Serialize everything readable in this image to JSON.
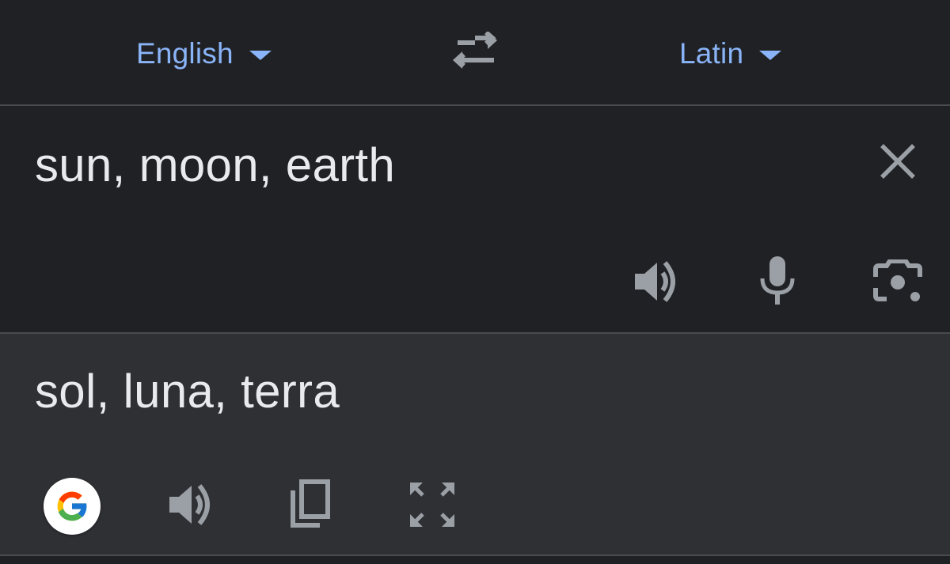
{
  "language_bar": {
    "source_language": "English",
    "target_language": "Latin"
  },
  "source": {
    "text": "sun, moon, earth"
  },
  "result": {
    "text": "sol, luna, terra"
  },
  "icons": {
    "swap": "swap-arrows-icon",
    "clear": "close-icon",
    "source_speaker": "speaker-icon",
    "mic": "microphone-icon",
    "camera": "camera-lens-icon",
    "google": "google-logo-icon",
    "result_speaker": "speaker-icon",
    "copy": "copy-icon",
    "fullscreen": "fullscreen-icon"
  },
  "colors": {
    "accent": "#8ab4f8",
    "text": "#e8eaed",
    "icon": "#9aa0a6",
    "background": "#202124",
    "result_background": "#2f3034",
    "divider": "#4a4b4e"
  }
}
